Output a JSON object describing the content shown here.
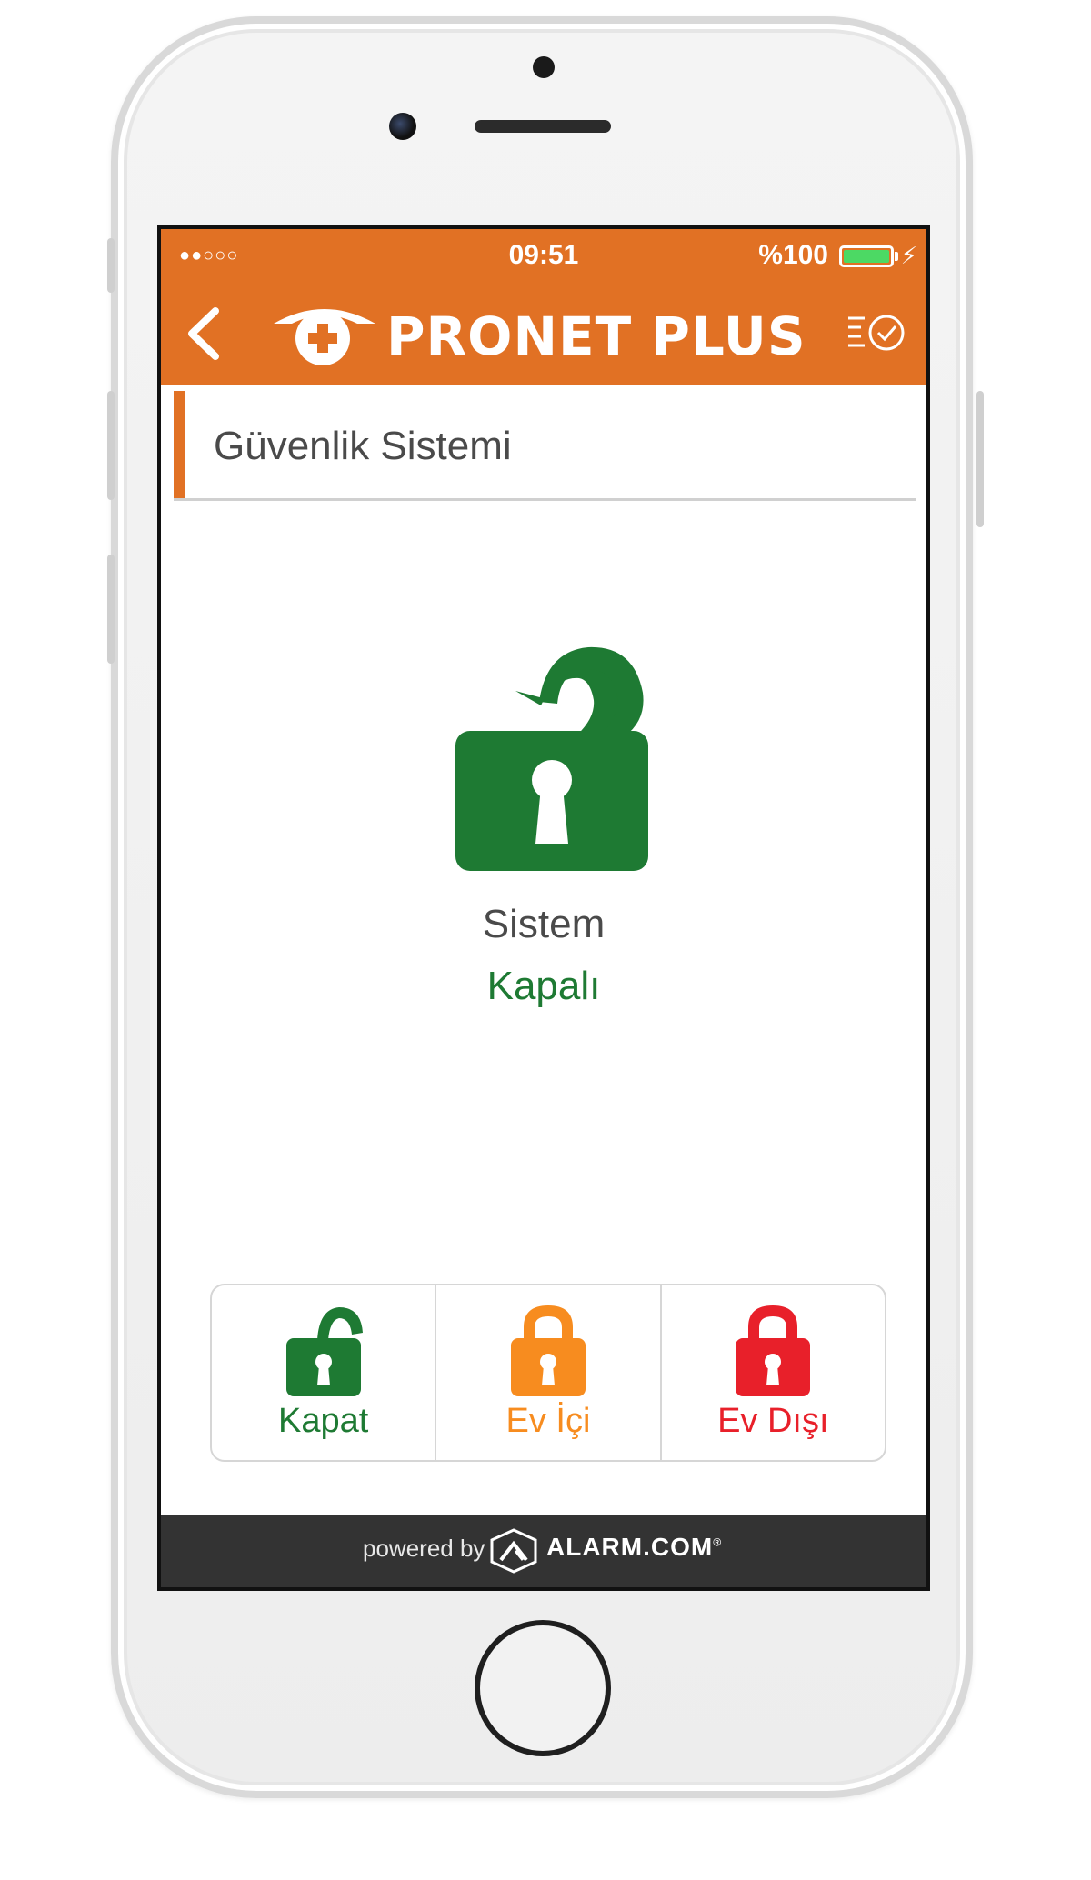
{
  "status_bar": {
    "signal": "●●○○○",
    "time": "09:51",
    "battery": "%100",
    "battery_level": 1.0
  },
  "header": {
    "brand": "PRONET PLUS",
    "back_icon": "chevron-left-icon",
    "menu_icon": "list-check-icon",
    "color": "#e17124"
  },
  "section": {
    "title": "Güvenlik Sistemi"
  },
  "system": {
    "label": "Sistem",
    "state": "Kapalı",
    "state_color": "#1e7a33",
    "icon": "unlocked-padlock-icon"
  },
  "modes": [
    {
      "label": "Kapat",
      "color": "#1e7a33",
      "icon": "unlocked-padlock-icon"
    },
    {
      "label": "Ev İçi",
      "color": "#f78c1f",
      "icon": "locked-padlock-icon"
    },
    {
      "label": "Ev Dışı",
      "color": "#e8202a",
      "icon": "locked-padlock-icon"
    }
  ],
  "footer": {
    "powered_by": "powered by",
    "brand": "ALARM.COM",
    "brand_mark": "®"
  }
}
